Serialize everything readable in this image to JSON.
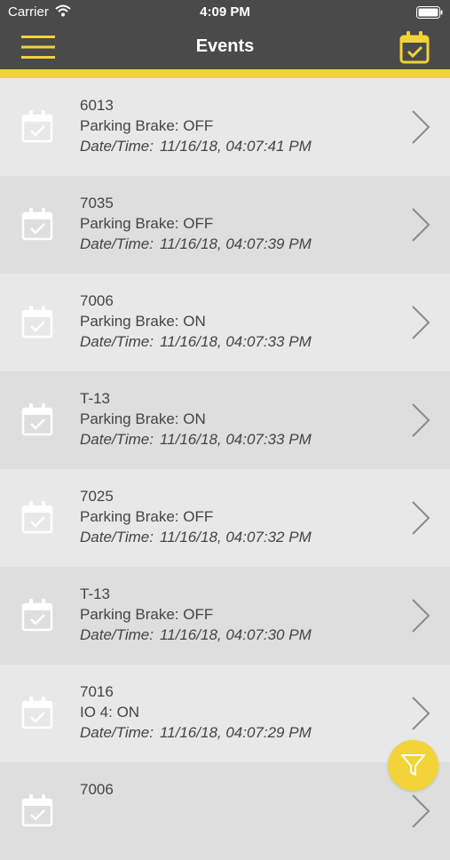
{
  "status_bar": {
    "carrier": "Carrier",
    "time": "4:09 PM"
  },
  "header": {
    "title": "Events"
  },
  "colors": {
    "accent": "#f2d338",
    "header_bg": "#4a4a4a"
  },
  "icons": {
    "menu": "hamburger-icon",
    "calendar": "calendar-check-icon",
    "filter": "filter-icon",
    "row_chevron": "chevron-right-icon"
  },
  "events": [
    {
      "unit": "6013",
      "description": "Parking Brake: OFF",
      "datetime_label": "Date/Time:",
      "datetime": "11/16/18, 04:07:41 PM"
    },
    {
      "unit": "7035",
      "description": "Parking Brake: OFF",
      "datetime_label": "Date/Time:",
      "datetime": "11/16/18, 04:07:39 PM"
    },
    {
      "unit": "7006",
      "description": "Parking Brake: ON",
      "datetime_label": "Date/Time:",
      "datetime": "11/16/18, 04:07:33 PM"
    },
    {
      "unit": "T-13",
      "description": "Parking Brake: ON",
      "datetime_label": "Date/Time:",
      "datetime": "11/16/18, 04:07:33 PM"
    },
    {
      "unit": "7025",
      "description": "Parking Brake: OFF",
      "datetime_label": "Date/Time:",
      "datetime": "11/16/18, 04:07:32 PM"
    },
    {
      "unit": "T-13",
      "description": "Parking Brake: OFF",
      "datetime_label": "Date/Time:",
      "datetime": "11/16/18, 04:07:30 PM"
    },
    {
      "unit": "7016",
      "description": "IO 4: ON",
      "datetime_label": "Date/Time:",
      "datetime": "11/16/18, 04:07:29 PM"
    },
    {
      "unit": "7006",
      "description": "",
      "datetime_label": "",
      "datetime": ""
    }
  ]
}
